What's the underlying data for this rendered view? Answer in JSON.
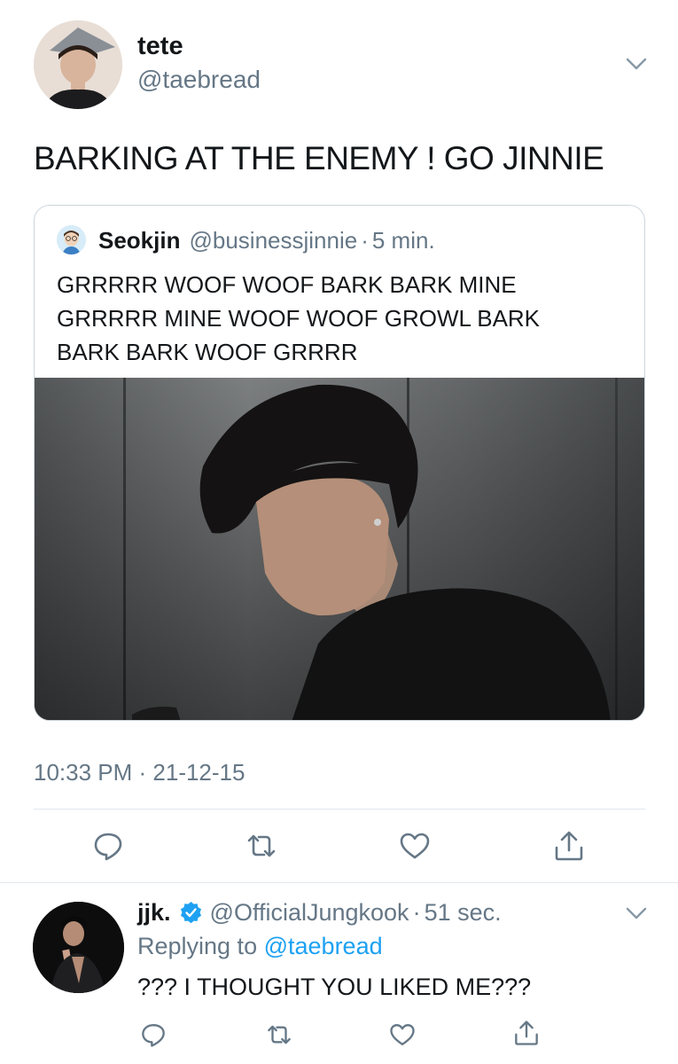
{
  "main_tweet": {
    "author_name": "tete",
    "author_handle": "@taebread",
    "text": "BARKING AT THE ENEMY ! GO JINNIE",
    "timestamp": "10:33 PM · 21-12-15",
    "avatar_icon": "avatar-photo",
    "menu_icon": "chevron-down-icon"
  },
  "quoted_tweet": {
    "author_name": "Seokjin",
    "author_handle": "@businessjinnie",
    "separator": "·",
    "time": "5 min.",
    "lines": [
      "GRRRRR WOOF WOOF BARK BARK MINE",
      "GRRRRR MINE WOOF WOOF GROWL BARK",
      "BARK BARK WOOF GRRRR"
    ],
    "media_icon": "photo-media"
  },
  "actions": {
    "icons": [
      "reply-icon",
      "retweet-icon",
      "like-icon",
      "share-icon"
    ]
  },
  "reply_tweet": {
    "author_name": "jjk.",
    "verified_icon": "verified-badge-icon",
    "author_handle": "@OfficialJungkook",
    "separator": "·",
    "time": "51 sec.",
    "replying_prefix": "Replying to",
    "replying_mention": "@taebread",
    "text": "??? I THOUGHT YOU LIKED ME???"
  },
  "colors": {
    "text_primary": "#14171a",
    "text_secondary": "#657786",
    "accent_blue": "#1da1f2",
    "border": "#ccd6dd",
    "divider": "#e1e8ed"
  }
}
